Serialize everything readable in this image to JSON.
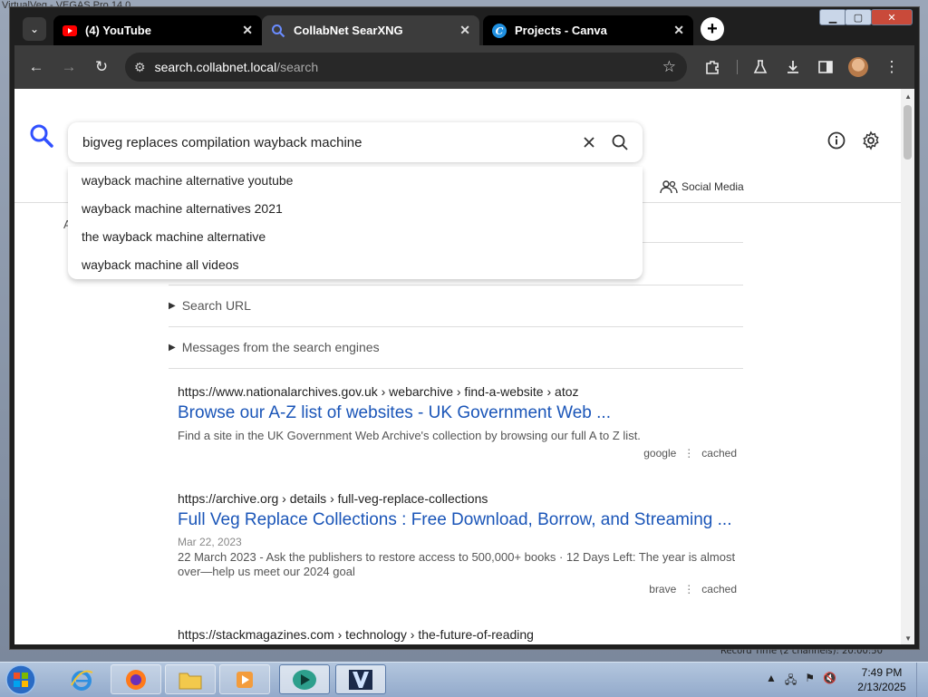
{
  "desktop": {
    "top_text": "VirtualVeg - VEGAS Pro 14.0",
    "bottom_text": "Record Time (2 channels): 20:00:50"
  },
  "tabs": [
    {
      "title": "(4) YouTube",
      "icon": "youtube-icon",
      "active": false
    },
    {
      "title": "CollabNet SearXNG",
      "icon": "search-icon",
      "active": true
    },
    {
      "title": "Projects - Canva",
      "icon": "canva-icon",
      "active": false
    }
  ],
  "window_controls": {
    "minimize": "▁",
    "maximize": "▢",
    "close": "✕"
  },
  "toolbar": {
    "url_domain": "search.collabnet.local",
    "url_path": "/search"
  },
  "search": {
    "query": "bigveg replaces compilation wayback machine",
    "suggestions": [
      "wayback machine alternative youtube",
      "wayback machine alternatives 2021",
      "the wayback machine alternative",
      "wayback machine all videos"
    ]
  },
  "categories": {
    "social_media": "Social Media"
  },
  "truncated_label": "A",
  "details": [
    {
      "label": "Search URL"
    },
    {
      "label": "Messages from the search engines"
    }
  ],
  "results": [
    {
      "url": "https://www.nationalarchives.gov.uk  › webarchive › find-a-website › atoz",
      "title": "Browse our A-Z list of websites - UK Government Web ...",
      "date": "",
      "desc": "Find a site in the UK Government Web Archive's collection by browsing our full A to Z list.",
      "engine": "google",
      "cached": "cached"
    },
    {
      "url": "https://archive.org  › details › full-veg-replace-collections",
      "title": "Full Veg Replace Collections : Free Download, Borrow, and Streaming ...",
      "date": "Mar 22, 2023",
      "desc": "22 March 2023 - Ask the publishers to restore access to 500,000+ books · 12 Days Left: The year is almost over—help us meet our 2024 goal",
      "engine": "brave",
      "cached": "cached"
    },
    {
      "url": "https://stackmagazines.com  › technology › the-future-of-reading",
      "title": "",
      "date": "",
      "desc": "",
      "engine": "",
      "cached": ""
    }
  ],
  "taskbar": {
    "time": "7:49 PM",
    "date": "2/13/2025"
  }
}
